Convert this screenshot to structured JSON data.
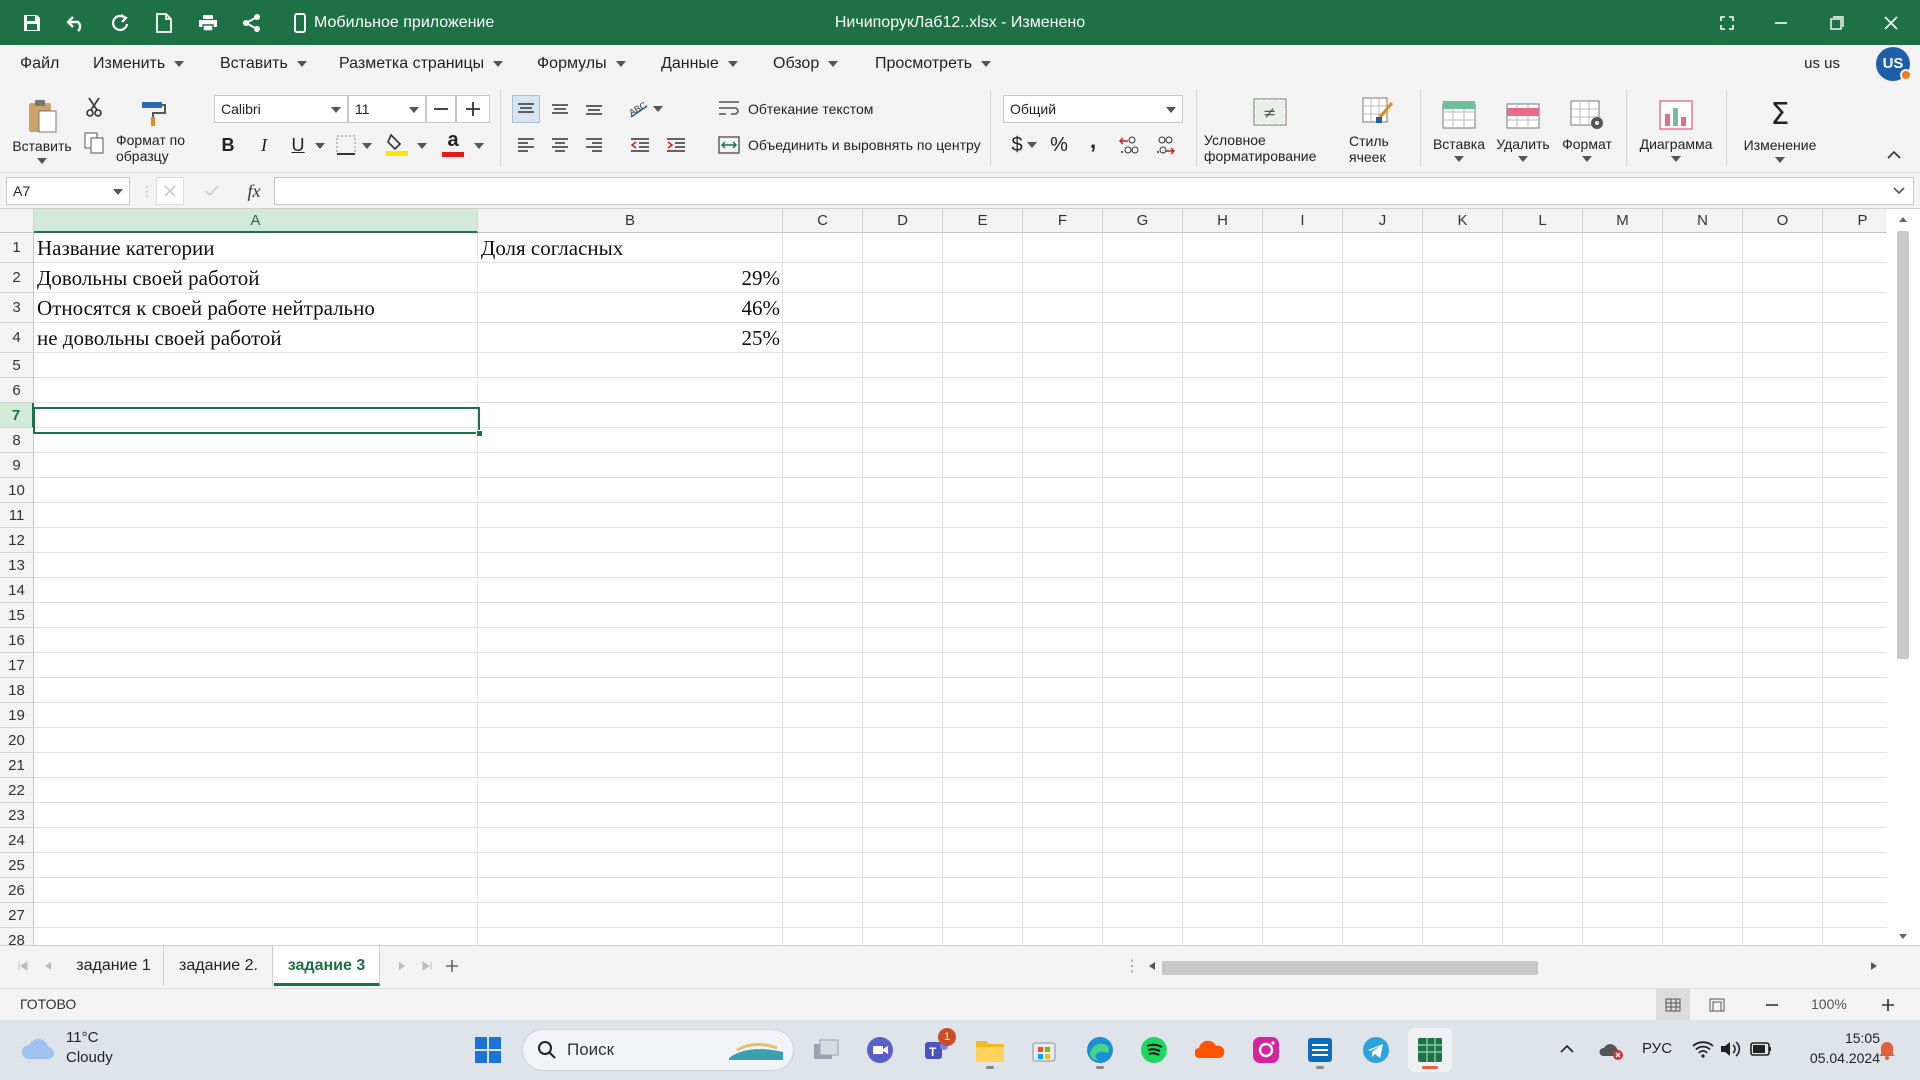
{
  "window": {
    "title": "НичипорукЛаб12..xlsx - Изменено",
    "mobile_app_label": "Мобильное приложение"
  },
  "menu": {
    "items": [
      "Файл",
      "Изменить",
      "Вставить",
      "Разметка страницы",
      "Формулы",
      "Данные",
      "Обзор",
      "Просмотреть"
    ],
    "user_name": "us us",
    "avatar_initials": "US"
  },
  "ribbon": {
    "paste_label": "Вставить",
    "format_painter_label": "Формат по образцу",
    "font_name": "Calibri",
    "font_size": "11",
    "wrap_text_label": "Обтекание текстом",
    "merge_center_label": "Объединить и выровнять по центру",
    "number_format": "Общий",
    "conditional_format_label": "Условное форматирование",
    "cell_styles_label": "Стиль ячеек",
    "insert_label": "Вставка",
    "delete_label": "Удалить",
    "format_label": "Формат",
    "chart_label": "Диаграмма",
    "editing_label": "Изменение",
    "bold": "B",
    "italic": "I",
    "underline": "U",
    "currency_symbol": "$",
    "percent_symbol": "%",
    "comma_symbol": ",",
    "font_color_letter": "a"
  },
  "formula_bar": {
    "name_box": "A7",
    "fx": "fx",
    "formula": ""
  },
  "sheet": {
    "columns": [
      "A",
      "B",
      "C",
      "D",
      "E",
      "F",
      "G",
      "H",
      "I",
      "J",
      "K",
      "L",
      "M",
      "N",
      "O",
      "P"
    ],
    "rows": [
      "1",
      "2",
      "3",
      "4",
      "5",
      "6",
      "7",
      "8",
      "9",
      "10",
      "11",
      "12",
      "13",
      "14",
      "15",
      "16",
      "17",
      "18",
      "19",
      "20",
      "21",
      "22",
      "23",
      "24",
      "25",
      "26",
      "27",
      "28"
    ],
    "selected_cell": "A7",
    "cells": {
      "A1": "Название категории",
      "B1": "Доля согласных",
      "A2": "Довольны своей работой",
      "B2": "29%",
      "A3": "Относятся к своей работе нейтрально",
      "B3": "46%",
      "A4": "не довольны своей работой",
      "B4": "25%"
    }
  },
  "tabs": [
    "задание 1",
    "задание 2.",
    "задание 3"
  ],
  "active_tab": "задание 3",
  "status": {
    "ready": "ГОТОВО",
    "zoom": "100%"
  },
  "taskbar": {
    "weather_temp": "11°C",
    "weather_desc": "Cloudy",
    "search_placeholder": "Поиск",
    "teams_badge": "1",
    "language": "РУС",
    "time": "15:05",
    "date": "05.04.2024"
  },
  "colors": {
    "brand_green": "#1e7145",
    "selection_fill": "#d3e9da"
  }
}
